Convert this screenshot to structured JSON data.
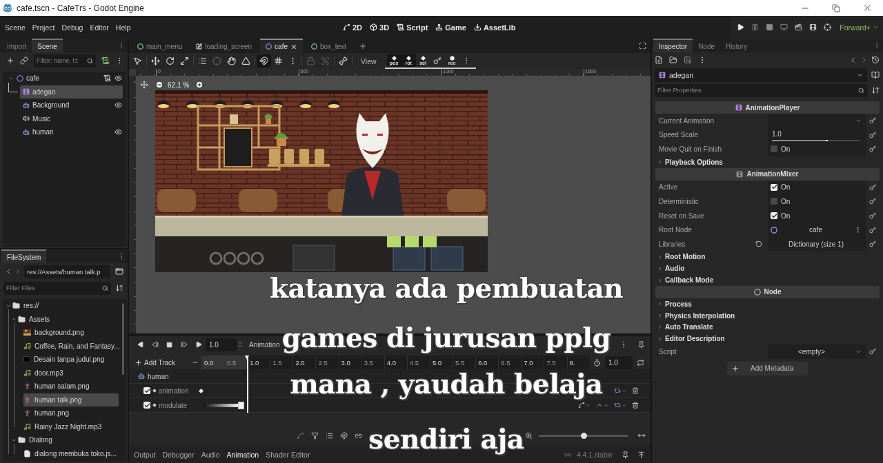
{
  "window": {
    "title": "cafe.tscn - CafeTrs - Godot Engine"
  },
  "menu_bar": [
    "Scene",
    "Project",
    "Debug",
    "Editor",
    "Help"
  ],
  "workspaces": [
    {
      "kind": "canvas",
      "label": "2D"
    },
    {
      "kind": "spatial",
      "label": "3D"
    },
    {
      "kind": "script",
      "label": "Script"
    },
    {
      "kind": "game",
      "label": "Game"
    },
    {
      "kind": "assetlib",
      "label": "AssetLib"
    }
  ],
  "renderer": "Forward+",
  "scene_dock": {
    "tabs": [
      {
        "label": "Import",
        "selected": false
      },
      {
        "label": "Scene",
        "selected": true
      }
    ],
    "filter": {
      "placeholder": "Filter: name, t:t"
    },
    "tree": [
      {
        "label": "cafe",
        "kind": "node2d",
        "selected": false,
        "expanded": true,
        "script": true,
        "visibility": true,
        "children": [
          {
            "label": "adegan",
            "kind": "animation-player",
            "selected": true,
            "script": false,
            "visibility": false
          },
          {
            "label": "Background",
            "kind": "sprite",
            "selected": false,
            "script": false,
            "visibility": true
          },
          {
            "label": "Music",
            "kind": "audio",
            "selected": false,
            "script": false,
            "visibility": false
          },
          {
            "label": "human",
            "kind": "sprite",
            "selected": false,
            "script": false,
            "visibility": true
          }
        ]
      }
    ]
  },
  "filesystem": {
    "tabs": [
      {
        "label": "FileSystem",
        "selected": true
      }
    ],
    "path": "res://Assets/human talk.p",
    "filter": {
      "placeholder": "Filter Files"
    },
    "tree": [
      {
        "label": "res://",
        "kind": "folder",
        "expanded": true,
        "selected": false,
        "children": [
          {
            "label": "Assets",
            "kind": "folder",
            "expanded": true,
            "selected": false,
            "children": [
              {
                "label": "background.png",
                "kind": "picture",
                "selected": false
              },
              {
                "label": "Coffee, Rain, and Fantasy...",
                "kind": "audio",
                "selected": false
              },
              {
                "label": "Desain tanpa judul.png",
                "kind": "blank-image",
                "selected": false
              },
              {
                "label": "door.mp3",
                "kind": "audio",
                "selected": false
              },
              {
                "label": "human salam.png",
                "kind": "figure",
                "selected": false
              },
              {
                "label": "human talk.png",
                "kind": "figure",
                "selected": true
              },
              {
                "label": "human.png",
                "kind": "figure",
                "selected": false
              },
              {
                "label": "Rainy Jazz Night.mp3",
                "kind": "audio",
                "selected": false
              }
            ]
          },
          {
            "label": "Dialong",
            "kind": "folder",
            "expanded": true,
            "selected": false,
            "children": [
              {
                "label": "dialong membuka toko.js...",
                "kind": "document",
                "selected": false
              }
            ]
          }
        ]
      }
    ]
  },
  "scene_tabs": [
    {
      "label": "main_menu",
      "kind": "control",
      "selected": false
    },
    {
      "label": "loading_screen",
      "kind": "canvas",
      "selected": false
    },
    {
      "label": "cafe",
      "kind": "node2d",
      "selected": true
    },
    {
      "label": "box_text",
      "kind": "control",
      "selected": false
    }
  ],
  "canvas_tools": [
    [
      {
        "kind": "select",
        "on": false,
        "disabled": false
      }
    ],
    [
      {
        "kind": "move",
        "on": false,
        "disabled": false
      },
      {
        "kind": "rotate",
        "on": false,
        "disabled": false
      },
      {
        "kind": "scale",
        "on": false,
        "disabled": false
      }
    ],
    [
      {
        "kind": "list-select",
        "on": false,
        "disabled": false
      },
      {
        "kind": "pivot",
        "on": false,
        "disabled": true
      },
      {
        "kind": "pan",
        "on": false,
        "disabled": false
      },
      {
        "kind": "ruler",
        "on": false,
        "disabled": false
      }
    ],
    [
      {
        "kind": "smart-snap",
        "on": true,
        "disabled": false
      },
      {
        "kind": "grid-snap",
        "on": false,
        "disabled": false
      },
      {
        "kind": "more",
        "on": false,
        "disabled": false
      }
    ],
    [
      {
        "kind": "lock",
        "on": false,
        "disabled": true
      },
      {
        "kind": "group",
        "on": false,
        "disabled": true
      }
    ],
    [
      {
        "kind": "skeleton",
        "on": false,
        "disabled": false
      }
    ]
  ],
  "view_menu": "View",
  "keying": [
    {
      "kind": "pos",
      "label": "pos",
      "selected": true
    },
    {
      "kind": "rot",
      "label": "rot",
      "selected": true
    },
    {
      "kind": "scl",
      "label": "scl",
      "selected": false
    },
    {
      "kind": "key",
      "selected": false
    },
    {
      "kind": "rec",
      "label": "rec",
      "selected": false
    }
  ],
  "viewport": {
    "rulers": [
      "0",
      "500",
      "1000",
      "1500"
    ],
    "zoom": "62.1 %"
  },
  "animation": {
    "speed": "1.0",
    "menu": "Animation",
    "add_track": "Add Track",
    "timeline": [
      {
        "label": "0.0",
        "major": true,
        "in_range": true
      },
      {
        "label": "0.5",
        "major": false,
        "in_range": true
      },
      {
        "label": "1.0",
        "major": true,
        "in_range": false
      },
      {
        "label": "1.5",
        "major": false,
        "in_range": false
      },
      {
        "label": "2.0",
        "major": true,
        "in_range": false
      },
      {
        "label": "2.5",
        "major": false,
        "in_range": false
      },
      {
        "label": "3.0",
        "major": true,
        "in_range": false
      },
      {
        "label": "3.5",
        "major": false,
        "in_range": false
      },
      {
        "label": "4.0",
        "major": true,
        "in_range": false
      },
      {
        "label": "4.5",
        "major": false,
        "in_range": false
      },
      {
        "label": "5.0",
        "major": true,
        "in_range": false
      },
      {
        "label": "5.5",
        "major": false,
        "in_range": false
      },
      {
        "label": "6.0",
        "major": true,
        "in_range": false
      },
      {
        "label": "6.5",
        "major": false,
        "in_range": false
      },
      {
        "label": "7.0",
        "major": true,
        "in_range": false
      },
      {
        "label": "7.5",
        "major": false,
        "in_range": false
      },
      {
        "label": "8.",
        "major": true,
        "in_range": false
      }
    ],
    "playhead": {
      "level": 0.119
    },
    "length": "1.0",
    "tracks": [
      {
        "kind": "node",
        "label": "human"
      },
      {
        "kind": "animation-track",
        "label": "animation",
        "enabled": true
      },
      {
        "kind": "value-track",
        "label": "modulate",
        "enabled": true
      }
    ],
    "zoom": {
      "level": 0.5
    }
  },
  "bottom_tabs": [
    {
      "label": "Output",
      "selected": false
    },
    {
      "label": "Debugger",
      "selected": false
    },
    {
      "label": "Audio",
      "selected": false
    },
    {
      "label": "Animation",
      "selected": true
    },
    {
      "label": "Shader Editor",
      "selected": false
    }
  ],
  "version": "4.4.1.stable",
  "inspector": {
    "tabs": [
      {
        "label": "Inspector",
        "selected": true
      },
      {
        "label": "Node",
        "selected": false
      },
      {
        "label": "History",
        "selected": false
      }
    ],
    "object": "adegan",
    "filter": {
      "placeholder": "Filter Properties"
    },
    "properties": [
      {
        "kind": "player-header",
        "label": "AnimationPlayer"
      },
      {
        "kind": "dropdown",
        "label": "Current Animation"
      },
      {
        "kind": "slider",
        "label": "Speed Scale",
        "value": "1.0",
        "level": 0.63
      },
      {
        "kind": "checkbox",
        "label": "Movie Quit on Finish",
        "checked": false,
        "text": "On"
      },
      {
        "kind": "group",
        "label": "Playback Options",
        "expanded": false
      },
      {
        "kind": "mixer-header",
        "label": "AnimationMixer"
      },
      {
        "kind": "checkbox",
        "label": "Active",
        "checked": true,
        "text": "On"
      },
      {
        "kind": "checkbox",
        "label": "Deterministic",
        "checked": false,
        "text": "On"
      },
      {
        "kind": "checkbox",
        "label": "Reset on Save",
        "checked": true,
        "text": "On"
      },
      {
        "kind": "node-path",
        "label": "Root Node",
        "value": "cafe"
      },
      {
        "kind": "dictionary",
        "label": "Libraries",
        "value": "Dictionary (size 1)"
      },
      {
        "kind": "group",
        "label": "Root Motion",
        "expanded": false
      },
      {
        "kind": "group",
        "label": "Audio",
        "expanded": false
      },
      {
        "kind": "group",
        "label": "Callback Mode",
        "expanded": false
      },
      {
        "kind": "node-header",
        "label": "Node"
      },
      {
        "kind": "group",
        "label": "Process",
        "expanded": false
      },
      {
        "kind": "group",
        "label": "Physics Interpolation",
        "expanded": false
      },
      {
        "kind": "group",
        "label": "Auto Translate",
        "expanded": false
      },
      {
        "kind": "group",
        "label": "Editor Description",
        "expanded": false
      },
      {
        "kind": "resource",
        "label": "Script",
        "value": "<empty>"
      }
    ],
    "add_metadata": "Add Metadata"
  },
  "caption_lines": [
    "katanya ada pembuatan",
    "games di jurusan pplg",
    "mana , yaudah belaja",
    "sendiri aja"
  ]
}
